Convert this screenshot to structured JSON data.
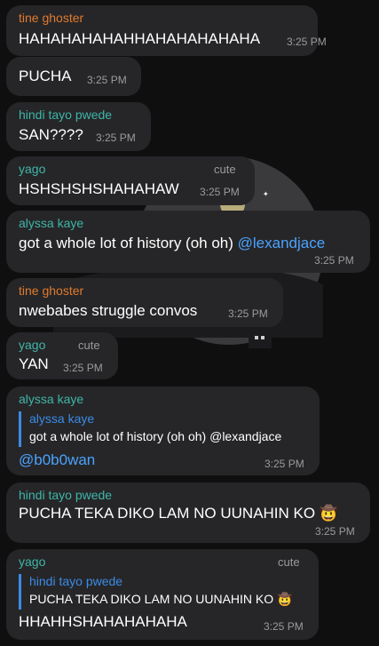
{
  "colors": {
    "background": "#0f0f10",
    "bubble": "#262628",
    "tine_ghoster": "#e07a2e",
    "hindi_tayo_pwede": "#3fb6a8",
    "yago": "#3fb6a8",
    "alyssa_kaye": "#3fb6a8",
    "mention": "#4aa3ff",
    "quote_accent": "#3b8be6"
  },
  "messages": [
    {
      "sender": "tine ghoster",
      "text": "HAHAHAHAHAHHAHAHAHAHAHA",
      "time": "3:25 PM"
    },
    {
      "text": "PUCHA",
      "time": "3:25 PM"
    },
    {
      "sender": "hindi tayo pwede",
      "text": "SAN????",
      "time": "3:25 PM"
    },
    {
      "sender": "yago",
      "rank": "cute",
      "text": "HSHSHSHSHAHAHAW",
      "time": "3:25 PM"
    },
    {
      "sender": "alyssa kaye",
      "text": "got a whole lot of history (oh oh) ",
      "mention": "@lexandjace",
      "time": "3:25 PM"
    },
    {
      "sender": "tine ghoster",
      "text": "nwebabes struggle convos",
      "time": "3:25 PM"
    },
    {
      "sender": "yago",
      "rank": "cute",
      "text": "YAN",
      "time": "3:25 PM"
    },
    {
      "sender": "alyssa kaye",
      "quote_name": "alyssa kaye",
      "quote_text": "got a whole lot of history (oh oh) @lexandjace",
      "mention": "@b0b0wan",
      "time": "3:25 PM"
    },
    {
      "sender": "hindi tayo pwede",
      "text": "PUCHA TEKA DIKO LAM NO UUNAHIN KO 🤠",
      "time": "3:25 PM"
    },
    {
      "sender": "yago",
      "rank": "cute",
      "quote_name": "hindi tayo pwede",
      "quote_text": "PUCHA TEKA DIKO LAM NO UUNAHIN KO 🤠",
      "text": "HHAHHSHAHAHAHAHA",
      "time": "3:25 PM"
    }
  ]
}
